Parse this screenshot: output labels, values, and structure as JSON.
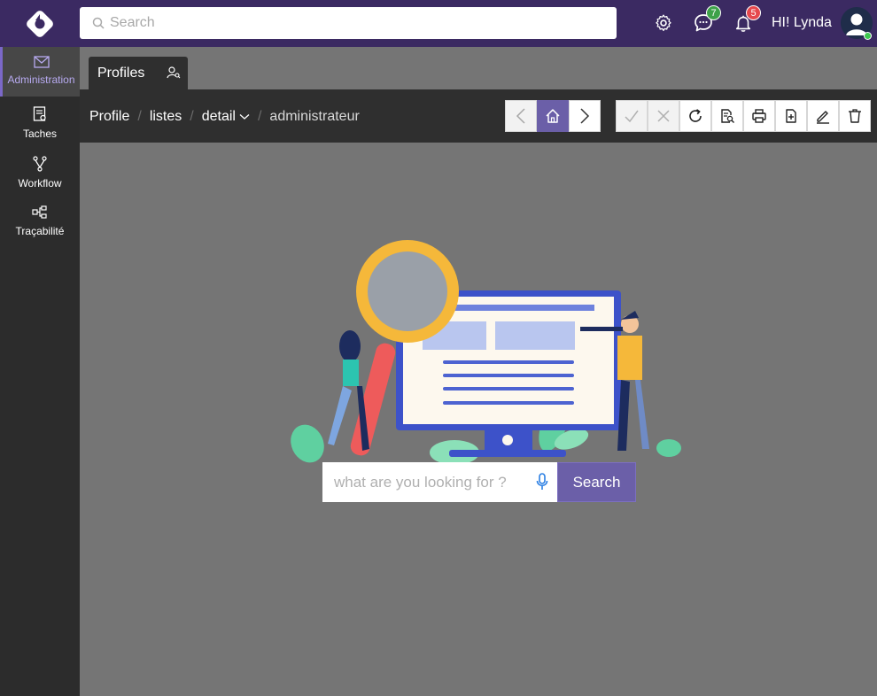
{
  "header": {
    "search_placeholder": "Search",
    "messages_count": "7",
    "notifications_count": "5",
    "greeting": "HI! Lynda"
  },
  "sidebar": {
    "items": [
      {
        "label": "Administration",
        "icon": "mail-icon",
        "active": true
      },
      {
        "label": "Taches",
        "icon": "task-list-icon",
        "active": false
      },
      {
        "label": "Workflow",
        "icon": "workflow-icon",
        "active": false
      },
      {
        "label": "Traçabilité",
        "icon": "traceability-icon",
        "active": false
      }
    ]
  },
  "tab": {
    "label": "Profiles",
    "icon": "user-search-icon"
  },
  "breadcrumb": {
    "items": [
      "Profile",
      "listes",
      "detail",
      "administrateur"
    ]
  },
  "toolbar": {
    "nav_buttons": [
      "previous-icon",
      "home-icon",
      "next-icon"
    ],
    "action_buttons": [
      "check-icon",
      "close-icon",
      "refresh-icon",
      "document-search-icon",
      "print-icon",
      "add-document-icon",
      "edit-icon",
      "delete-icon"
    ]
  },
  "main": {
    "search_placeholder": "what are you looking for ?",
    "search_button": "Search"
  },
  "colors": {
    "topbar": "#3b2a62",
    "accent": "#6b5fa8",
    "sidebar": "#2c2c2c",
    "content_bg": "#757575"
  }
}
